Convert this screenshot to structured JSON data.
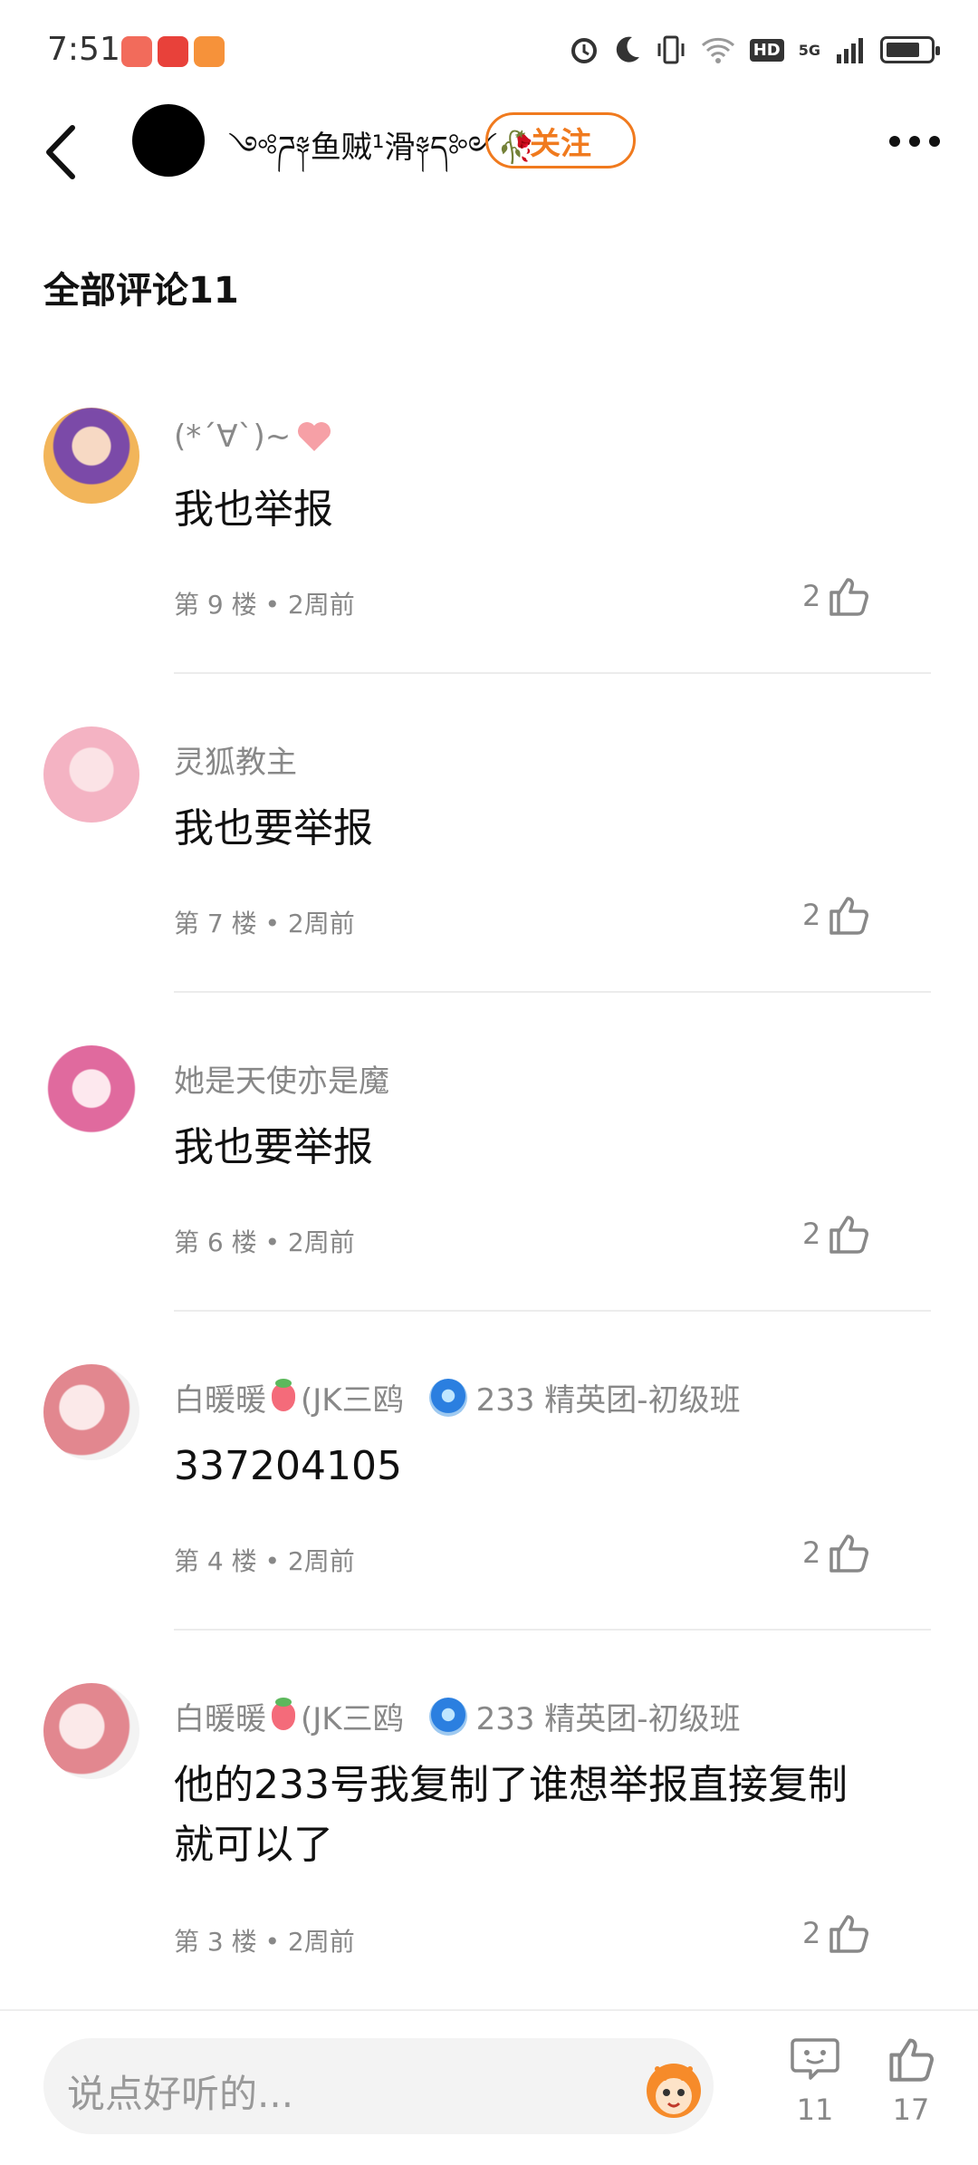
{
  "status_bar": {
    "time": "7:51",
    "network": "5G",
    "hd": "HD"
  },
  "header": {
    "username": "༺ཌ༈鱼贼¹滑༈ད༻🥀",
    "follow_label": "关注"
  },
  "section": {
    "title": "全部评论11"
  },
  "comments": [
    {
      "name": "(*´∀`)~",
      "text": "我也举报",
      "floor": "第 9 楼 • 2周前",
      "likes": "2",
      "badge": ""
    },
    {
      "name": "灵狐教主",
      "text": "我也要举报",
      "floor": "第 7 楼 • 2周前",
      "likes": "2",
      "badge": ""
    },
    {
      "name": "她是天使亦是魔",
      "text": "我也要举报",
      "floor": "第 6 楼 • 2周前",
      "likes": "2",
      "badge": ""
    },
    {
      "name": "白暖暖",
      "name_suffix": "(JK三鸥",
      "text": "337204105",
      "floor": "第 4 楼 • 2周前",
      "likes": "2",
      "badge": "233 精英团-初级班"
    },
    {
      "name": "白暖暖",
      "name_suffix": "(JK三鸥",
      "text": "他的233号我复制了谁想举报直接复制就可以了",
      "floor": "第 3 楼 • 2周前",
      "likes": "2",
      "badge": "233 精英团-初级班"
    }
  ],
  "bottom_bar": {
    "input_placeholder": "说点好听的...",
    "comment_count": "11",
    "like_count": "17"
  },
  "colors": {
    "accent": "#f07a1e",
    "muted": "#888888"
  }
}
